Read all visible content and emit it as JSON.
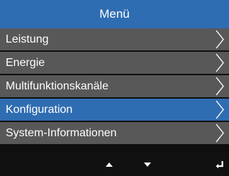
{
  "title": "Menü",
  "menu_items": [
    {
      "label": "Leistung"
    },
    {
      "label": "Energie"
    },
    {
      "label": "Multifunktionskanäle"
    },
    {
      "label": "Konfiguration",
      "selected": true
    },
    {
      "label": "System-Informationen"
    }
  ],
  "bottom_buttons": [
    {
      "icon": "arrow-up-icon"
    },
    {
      "icon": "arrow-down-icon"
    },
    {
      "icon": "enter-return-icon"
    }
  ],
  "colors": {
    "accent": "#2f6db2",
    "item_bg": "#585858",
    "background": "#0f0f0f",
    "text": "#ffffff"
  }
}
